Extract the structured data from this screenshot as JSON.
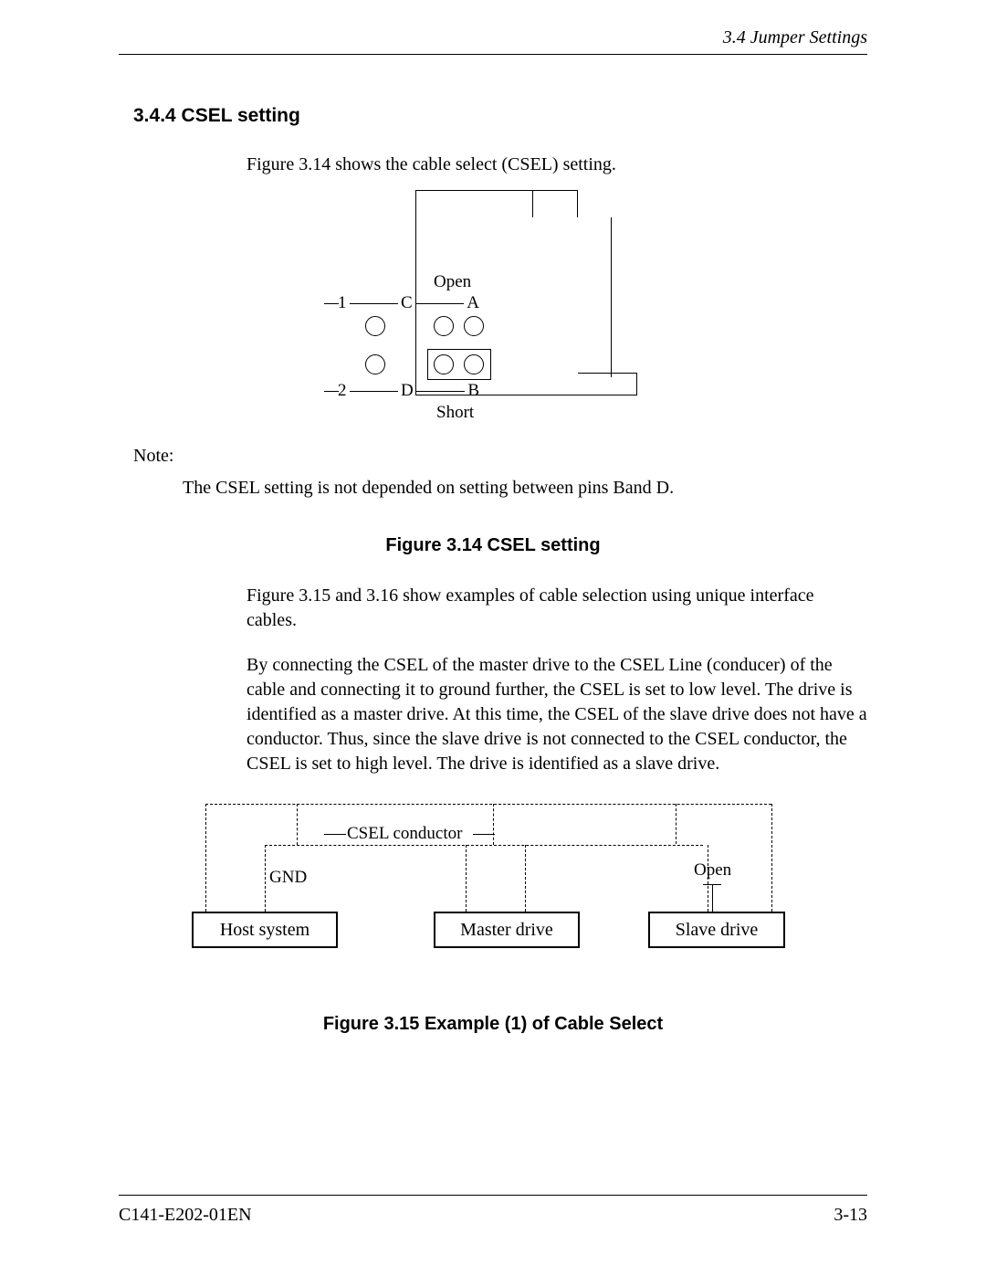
{
  "header": {
    "section_ref": "3.4  Jumper Settings"
  },
  "section": {
    "number_title": "3.4.4  CSEL setting",
    "intro": "Figure 3.14 shows the cable select (CSEL) setting."
  },
  "fig14": {
    "open": "Open",
    "row1": {
      "n": "1",
      "c": "C",
      "a": "A"
    },
    "row2": {
      "n": "2",
      "d": "D",
      "b": "B"
    },
    "short": "Short",
    "caption": "Figure 3.14  CSEL setting"
  },
  "note": {
    "label": "Note:",
    "text": "The CSEL setting is not depended on setting between pins Band D."
  },
  "para2": "Figure 3.15 and 3.16 show examples of cable selection using unique interface cables.",
  "para3": "By connecting the CSEL of the master drive to the CSEL Line (conducer) of the cable and connecting it to ground further, the CSEL is set to low level.  The drive is identified as a master drive.  At this time, the CSEL of the slave drive does not have a conductor.  Thus, since the slave drive is not connected to the CSEL conductor, the CSEL is set to high level.  The drive is identified as a slave drive.",
  "fig15": {
    "csel_conductor": "CSEL conductor",
    "gnd": "GND",
    "open": "Open",
    "host": "Host system",
    "master": "Master drive",
    "slave": "Slave drive",
    "caption": "Figure 3.15  Example (1) of Cable Select"
  },
  "footer": {
    "left": "C141-E202-01EN",
    "right": "3-13"
  }
}
